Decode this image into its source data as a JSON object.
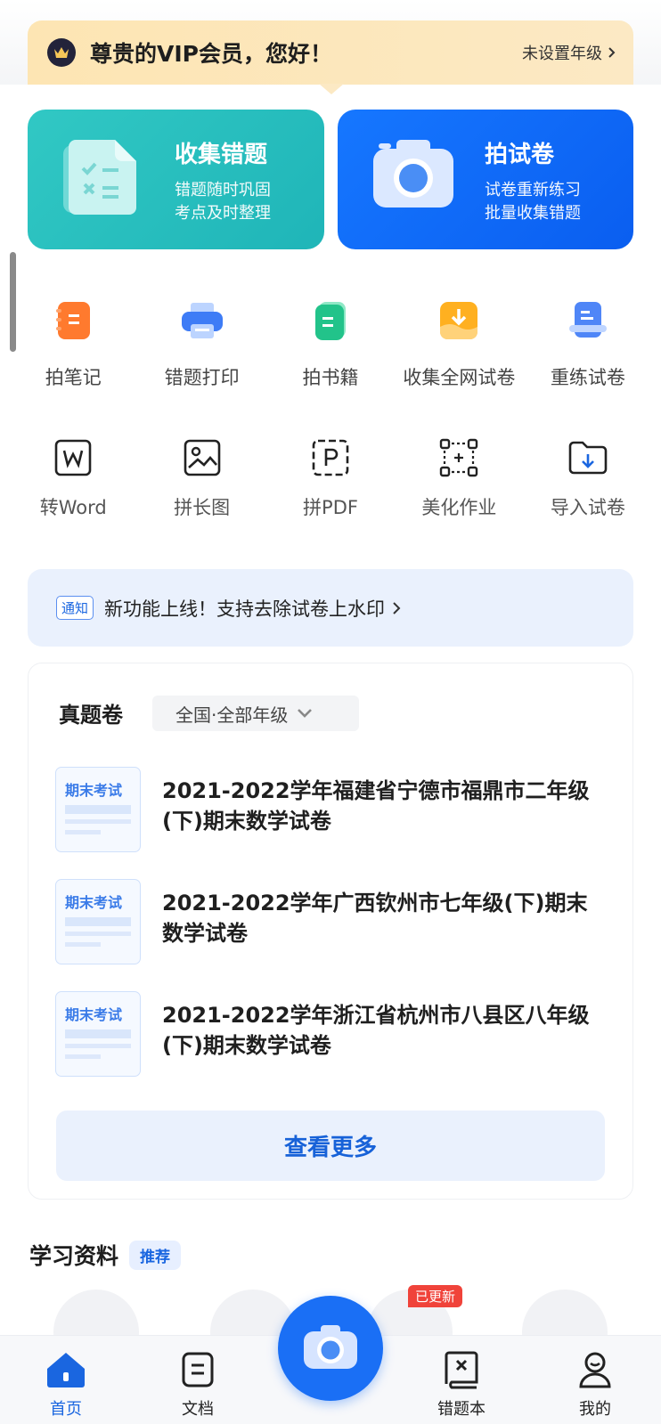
{
  "vip_banner": {
    "greeting": "尊贵的VIP会员，您好！",
    "grade": "未设置年级"
  },
  "cards": [
    {
      "title": "收集错题",
      "line1": "错题随时巩固",
      "line2": "考点及时整理",
      "color": "#2bc0c0"
    },
    {
      "title": "拍试卷",
      "line1": "试卷重新练习",
      "line2": "批量收集错题",
      "color": "#0f66f5"
    }
  ],
  "tools_row1": [
    {
      "label": "拍笔记",
      "icon": "notebook-icon"
    },
    {
      "label": "错题打印",
      "icon": "printer-icon"
    },
    {
      "label": "拍书籍",
      "icon": "book-icon"
    },
    {
      "label": "收集全网试卷",
      "icon": "download-icon"
    },
    {
      "label": "重练试卷",
      "icon": "redo-paper-icon"
    }
  ],
  "tools_row2": [
    {
      "label": "转Word",
      "icon": "word-icon"
    },
    {
      "label": "拼长图",
      "icon": "image-icon"
    },
    {
      "label": "拼PDF",
      "icon": "pdf-icon"
    },
    {
      "label": "美化作业",
      "icon": "beautify-icon"
    },
    {
      "label": "导入试卷",
      "icon": "import-folder-icon"
    }
  ],
  "notice": {
    "tag": "通知",
    "text": "新功能上线！支持去除试卷上水印"
  },
  "exam_section": {
    "heading": "真题卷",
    "filter": "全国·全部年级",
    "thumb_label": "期末考试",
    "items": [
      {
        "title": "2021-2022学年福建省宁德市福鼎市二年级(下)期末数学试卷"
      },
      {
        "title": "2021-2022学年广西钦州市七年级(下)期末数学试卷"
      },
      {
        "title": "2021-2022学年浙江省杭州市八县区八年级(下)期末数学试卷"
      }
    ],
    "more": "查看更多"
  },
  "study": {
    "heading": "学习资料",
    "badge": "推荐",
    "updated_badge": "已更新"
  },
  "tabbar": [
    {
      "label": "首页",
      "icon": "home-icon",
      "active": true
    },
    {
      "label": "文档",
      "icon": "document-icon"
    },
    {
      "label": "错题本",
      "icon": "mistake-book-icon"
    },
    {
      "label": "我的",
      "icon": "profile-icon"
    }
  ],
  "colors": {
    "accent": "#1a66e0",
    "vip_bg": "#fce6b8",
    "notice_bg": "#eaf1fd"
  }
}
